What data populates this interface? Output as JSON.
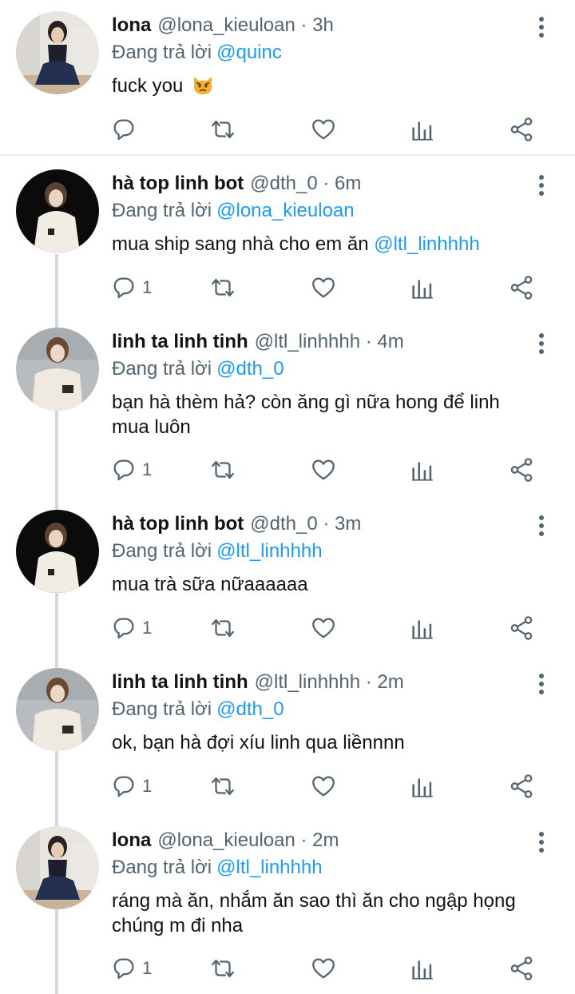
{
  "reply_prefix": "Đang trả lời",
  "tweets": [
    {
      "name": "lona",
      "handle": "@lona_kieuloan",
      "time": "· 3h",
      "reply_to": "@quinc",
      "text": "fuck you",
      "emoji": "pouting-cat",
      "reply_count": ""
    },
    {
      "name": "hà top linh bot",
      "handle": "@dth_0",
      "time": "· 6m",
      "reply_to": "@lona_kieuloan",
      "text": "mua ship sang nhà cho em ăn",
      "mention": "@ltl_linhhhh",
      "reply_count": "1"
    },
    {
      "name": "linh ta linh tinh",
      "handle": "@ltl_linhhhh",
      "time": "· 4m",
      "reply_to": "@dth_0",
      "text": "bạn hà thèm hả? còn ăng gì nữa hong để linh mua luôn",
      "reply_count": "1"
    },
    {
      "name": "hà top linh bot",
      "handle": "@dth_0",
      "time": "· 3m",
      "reply_to": "@ltl_linhhhh",
      "text": "mua trà sữa nữaaaaaa",
      "reply_count": "1"
    },
    {
      "name": "linh ta linh tinh",
      "handle": "@ltl_linhhhh",
      "time": "· 2m",
      "reply_to": "@dth_0",
      "text": "ok, bạn hà đợi xíu linh qua liềnnnn",
      "reply_count": "1"
    },
    {
      "name": "lona",
      "handle": "@lona_kieuloan",
      "time": "· 2m",
      "reply_to": "@ltl_linhhhh",
      "text": "ráng mà ăn, nhắm ăn sao thì ăn cho ngập họng chúng m đi nha",
      "reply_count": "1"
    }
  ],
  "colors": {
    "link": "#1d9bf0",
    "secondary_text": "#536471",
    "thread_line": "#cfd9de"
  }
}
